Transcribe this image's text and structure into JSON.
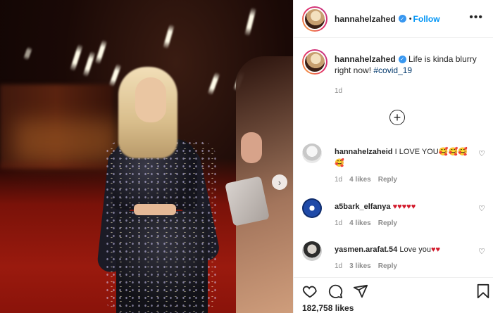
{
  "post": {
    "username": "hannahelzahed",
    "verified": true,
    "follow_label": "Follow",
    "separator": "•",
    "more": "•••",
    "caption_text": "Life is kinda blurry right now!",
    "hashtag": "#covid_19",
    "caption_time": "1d",
    "load_more": "+",
    "next": "›"
  },
  "comments": [
    {
      "username": "hannahelzaheid",
      "text": "I LOVE YOU",
      "emoji": "🥰🥰🥰🥰",
      "time": "1d",
      "likes": "4 likes",
      "reply": "Reply"
    },
    {
      "username": "a5bark_elfanya",
      "text": "",
      "hearts": "♥♥♥♥♥",
      "time": "1d",
      "likes": "4 likes",
      "reply": "Reply"
    },
    {
      "username": "yasmen.arafat.54",
      "text": "Love you",
      "hearts": "♥♥",
      "time": "1d",
      "likes": "3 likes",
      "reply": "Reply"
    }
  ],
  "actions": {
    "like_icon": "heart-outline-icon",
    "comment_icon": "comment-bubble-icon",
    "share_icon": "paper-plane-icon",
    "save_icon": "bookmark-icon",
    "likes_count": "182,758 likes"
  },
  "colors": {
    "accent": "#0095f6",
    "verified": "#3897f0",
    "hashtag": "#00376b",
    "heart_red": "#d2192b"
  }
}
